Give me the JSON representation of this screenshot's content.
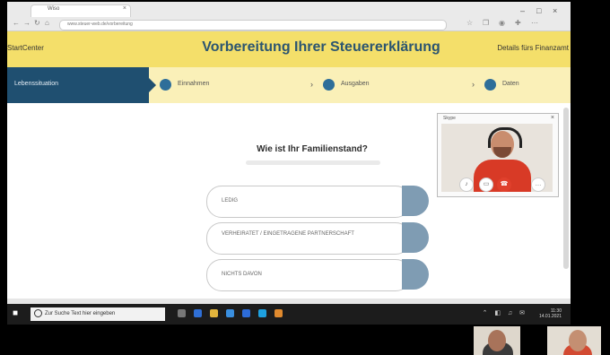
{
  "browser": {
    "tab_title": "Wiso",
    "url": "www.steuer-web.de/vorbereitung",
    "nav_icons": [
      "←",
      "→",
      "↻",
      "⌂"
    ]
  },
  "header": {
    "left_link": "StartCenter",
    "title": "Vorbereitung Ihrer Steuererklärung",
    "right_link": "Details fürs Finanzamt"
  },
  "steps": {
    "active": "Lebenssituation",
    "items": [
      "Einnahmen",
      "Ausgaben",
      "Daten"
    ]
  },
  "question": {
    "title": "Wie ist Ihr Familienstand?"
  },
  "options": [
    {
      "label": "LEDIG"
    },
    {
      "label": "VERHEIRATET / EINGETRAGENE PARTNERSCHAFT"
    },
    {
      "label": "NICHTS DAVON"
    }
  ],
  "video_call": {
    "window_title": "Skype"
  },
  "taskbar": {
    "search_placeholder": "Zur Suche Text hier eingeben",
    "time": "11:30",
    "date": "14.01.2021"
  },
  "colors": {
    "header_yellow": "#f4df6a",
    "steps_yellow": "#faf0b8",
    "primary_blue": "#1f4f70",
    "option_tab": "#7f9cb3"
  }
}
